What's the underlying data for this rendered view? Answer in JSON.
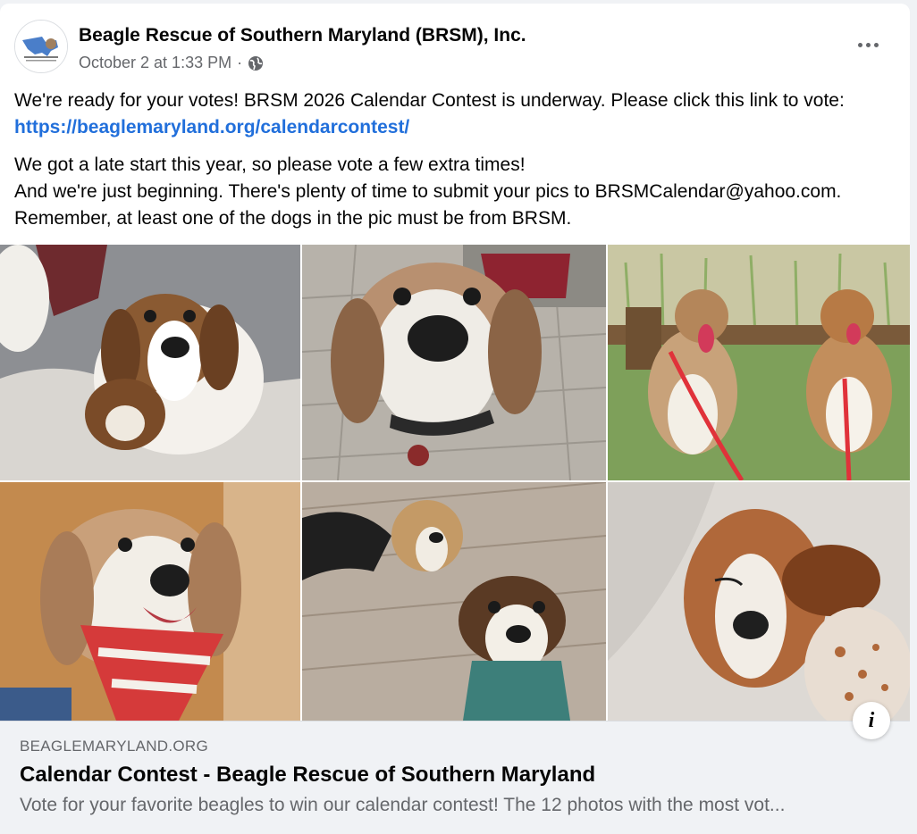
{
  "post": {
    "page_name": "Beagle Rescue of Southern Maryland (BRSM), Inc.",
    "timestamp": "October 2 at 1:33 PM",
    "separator": "·",
    "audience_icon": "globe-icon",
    "more_icon": "more-options-icon",
    "text": {
      "para1_pre": "We're ready for your votes! BRSM 2026 Calendar Contest is underway. Please click this link to vote: ",
      "link": "https://beaglemaryland.org/calendarcontest/",
      "para2_line1": "We got a late start this year, so please vote a few extra times!",
      "para2_line2": "And we're just beginning. There's plenty of time to submit your pics to BRSMCalendar@yahoo.com. Remember, at least one of the dogs in the pic must be from BRSM."
    }
  },
  "photos": [
    {
      "name": "beagles-on-blanket"
    },
    {
      "name": "beagle-on-patio"
    },
    {
      "name": "two-beagles-on-grass"
    },
    {
      "name": "beagle-in-bandana"
    },
    {
      "name": "beagles-on-wood-floor"
    },
    {
      "name": "beagle-on-cushion"
    }
  ],
  "link_preview": {
    "domain": "BEAGLEMARYLAND.ORG",
    "title": "Calendar Contest - Beagle Rescue of Southern Maryland",
    "description": "Vote for your favorite beagles to win our calendar contest! The 12 photos with the most vot...",
    "info_label": "i"
  },
  "colors": {
    "link": "#216fdb",
    "secondary_text": "#65676b",
    "preview_bg": "#f0f2f5"
  }
}
